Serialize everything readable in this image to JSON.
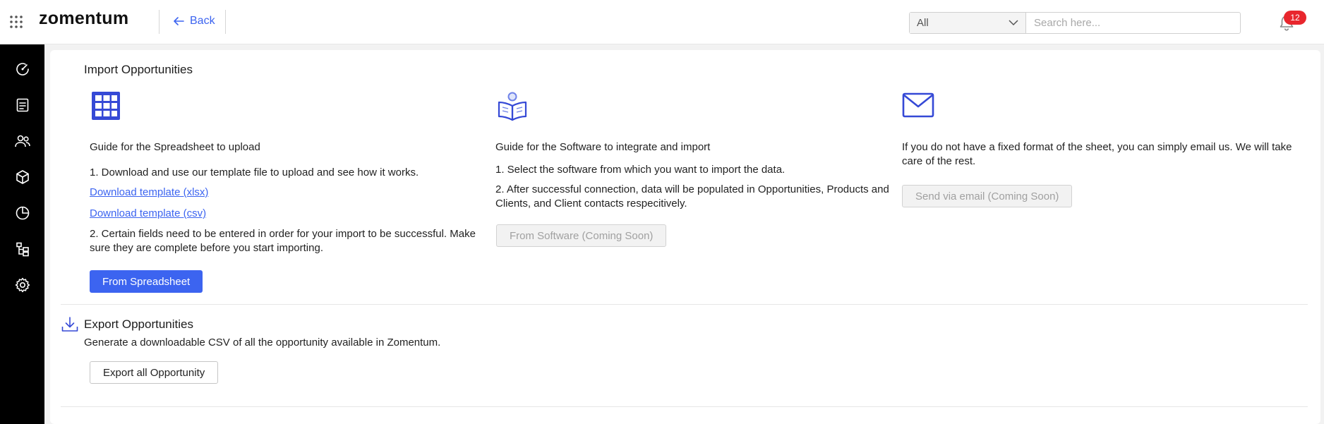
{
  "header": {
    "logo_text": "zomentum",
    "back_label": "Back",
    "search": {
      "filter_value": "All",
      "placeholder": "Search here..."
    },
    "notifications": {
      "count": "12",
      "badge_color": "#e8262d"
    }
  },
  "sidebar": {
    "items": [
      {
        "icon": "dashboard-gauge-icon"
      },
      {
        "icon": "document-icon"
      },
      {
        "icon": "users-icon"
      },
      {
        "icon": "package-box-icon"
      },
      {
        "icon": "pie-chart-icon"
      },
      {
        "icon": "workflow-icon"
      },
      {
        "icon": "gear-icon"
      }
    ]
  },
  "import": {
    "title": "Import Opportunities",
    "spreadsheet": {
      "icon": "grid-spreadsheet-icon",
      "guide_title": "Guide for the Spreadsheet to upload",
      "step1": "1. Download and use our template file to upload and see how it works.",
      "link_xlsx": "Download template (xlsx)",
      "link_csv": "Download template (csv)",
      "step2": "2. Certain fields need to be entered in order for your import to be successful. Make sure they are complete before you start importing.",
      "button": "From Spreadsheet"
    },
    "software": {
      "icon": "book-reader-icon",
      "guide_title": "Guide for the Software to integrate and import",
      "step1": "1. Select the software from which you want to import the data.",
      "step2": "2. After successful connection, data will be populated in Opportunities, Products and Clients, and Client contacts respecitively.",
      "button": "From Software (Coming Soon)"
    },
    "email": {
      "icon": "envelope-icon",
      "description": "If you do not have a fixed format of the sheet, you can simply email us. We will take care of the rest.",
      "button": "Send via email (Coming Soon)"
    }
  },
  "export": {
    "icon": "download-icon",
    "title": "Export Opportunities",
    "description": "Generate a downloadable CSV of all the opportunity available in Zomentum.",
    "button": "Export all Opportunity"
  },
  "colors": {
    "accent": "#3c64f0",
    "sidebar_bg": "#000000",
    "icon_blue": "#3549d6"
  }
}
